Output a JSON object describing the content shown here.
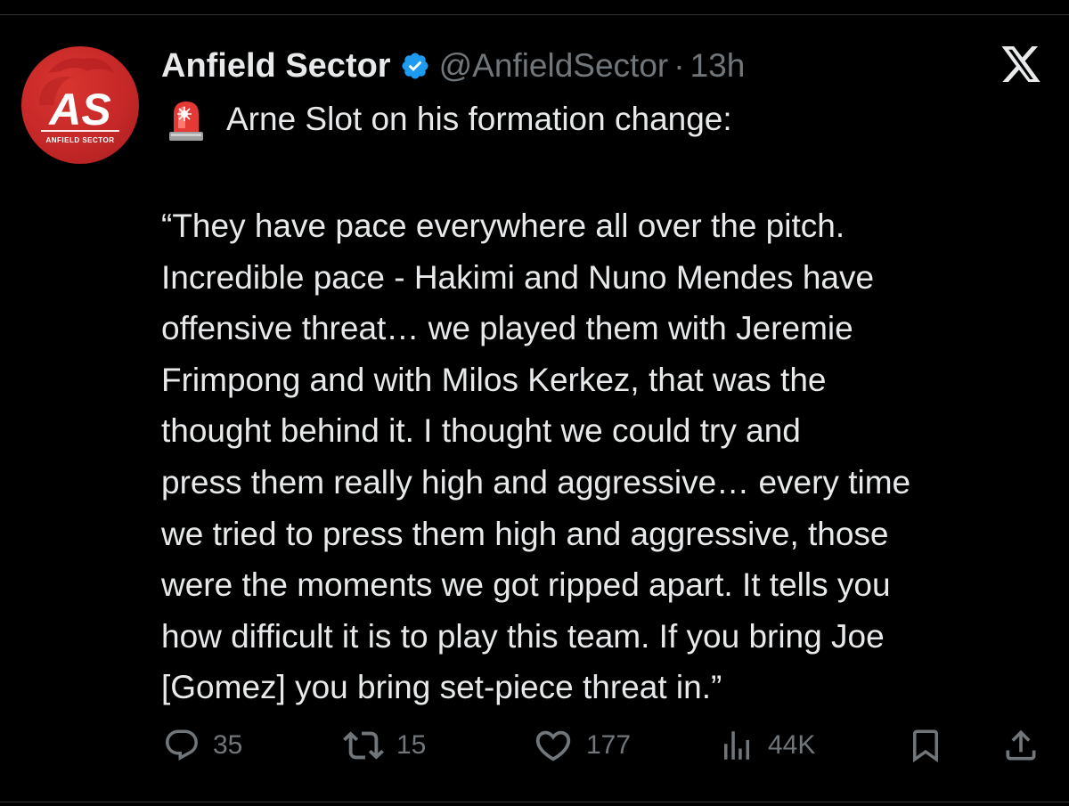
{
  "account": {
    "display_name": "Anfield Sector",
    "handle": "@AnfieldSector",
    "separator": "·",
    "time": "13h",
    "avatar_text": "AS",
    "avatar_subtext": "ANFIELD SECTOR",
    "verified_icon": "verified-badge-icon"
  },
  "post": {
    "siren_icon": "siren-emoji",
    "headline": "Arne Slot on his formation change:",
    "quote_lines": [
      "“They have pace everywhere all over the pitch.",
      "Incredible pace - Hakimi and Nuno Mendes have",
      "offensive threat… we played them with Jeremie",
      "Frimpong and with Milos Kerkez, that was the",
      "thought behind it. I thought we could try and",
      "press them really high and aggressive… every time",
      "we tried to press them high and aggressive, those",
      "were the moments we got ripped apart. It tells you",
      "how difficult it is to play this team. If you bring Joe",
      "[Gomez] you bring set-piece threat in.”"
    ]
  },
  "actions": {
    "replies": {
      "icon": "reply-icon",
      "count": "35"
    },
    "reposts": {
      "icon": "repost-icon",
      "count": "15"
    },
    "likes": {
      "icon": "heart-icon",
      "count": "177"
    },
    "views": {
      "icon": "views-icon",
      "count": "44K"
    },
    "bookmark": {
      "icon": "bookmark-icon"
    },
    "share": {
      "icon": "share-icon"
    }
  },
  "colors": {
    "background": "#000000",
    "text_primary": "#e7e9ea",
    "text_secondary": "#71767b",
    "verified_blue": "#1d9bf0",
    "avatar_red": "#c62828"
  }
}
